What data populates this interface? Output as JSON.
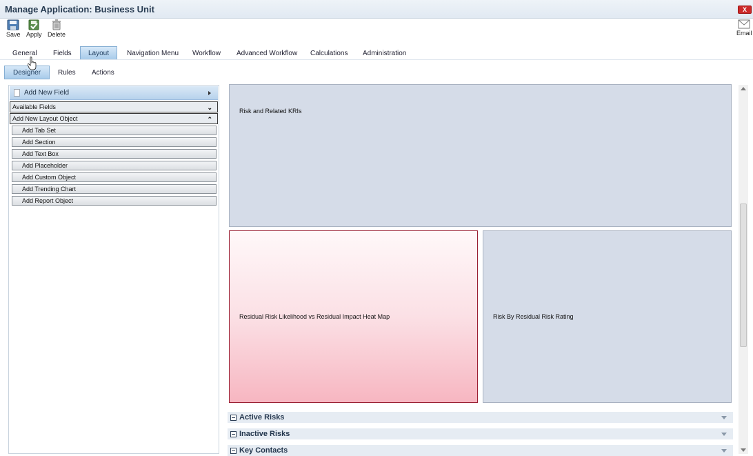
{
  "window": {
    "title": "Manage Application: Business Unit",
    "close_label": "X"
  },
  "toolbar": {
    "save_label": "Save",
    "apply_label": "Apply",
    "delete_label": "Delete",
    "email_label": "Email"
  },
  "main_tabs": [
    {
      "label": "General"
    },
    {
      "label": "Fields"
    },
    {
      "label": "Layout",
      "active": true
    },
    {
      "label": "Navigation Menu"
    },
    {
      "label": "Workflow"
    },
    {
      "label": "Advanced Workflow"
    },
    {
      "label": "Calculations"
    },
    {
      "label": "Administration"
    }
  ],
  "sub_tabs": [
    {
      "label": "Designer",
      "active": true
    },
    {
      "label": "Rules"
    },
    {
      "label": "Actions"
    }
  ],
  "left_panel": {
    "add_new_field": "Add New Field",
    "available_fields": "Available Fields",
    "add_new_layout_object": "Add New Layout Object",
    "layout_objects": [
      "Add Tab Set",
      "Add Section",
      "Add Text Box",
      "Add Placeholder",
      "Add Custom Object",
      "Add Trending Chart",
      "Add Report Object"
    ]
  },
  "canvas": {
    "box_top": "Risk and Related KRIs",
    "box_left": "Residual Risk Likelihood vs Residual Impact Heat Map",
    "box_right": "Risk By Residual Risk Rating",
    "sections": [
      "Active Risks",
      "Inactive Risks",
      "Key Contacts"
    ]
  },
  "colors": {
    "accent_tab": "#a8cbea",
    "box_fill": "#d5dce8",
    "selected_box_border": "#9a1f33",
    "section_title": "#23364d"
  },
  "icons": [
    "save-icon",
    "apply-icon",
    "delete-icon",
    "email-icon",
    "close-icon",
    "page-icon",
    "chevron-down-icon",
    "chevron-up-icon",
    "minus-icon",
    "caret-down-icon"
  ]
}
